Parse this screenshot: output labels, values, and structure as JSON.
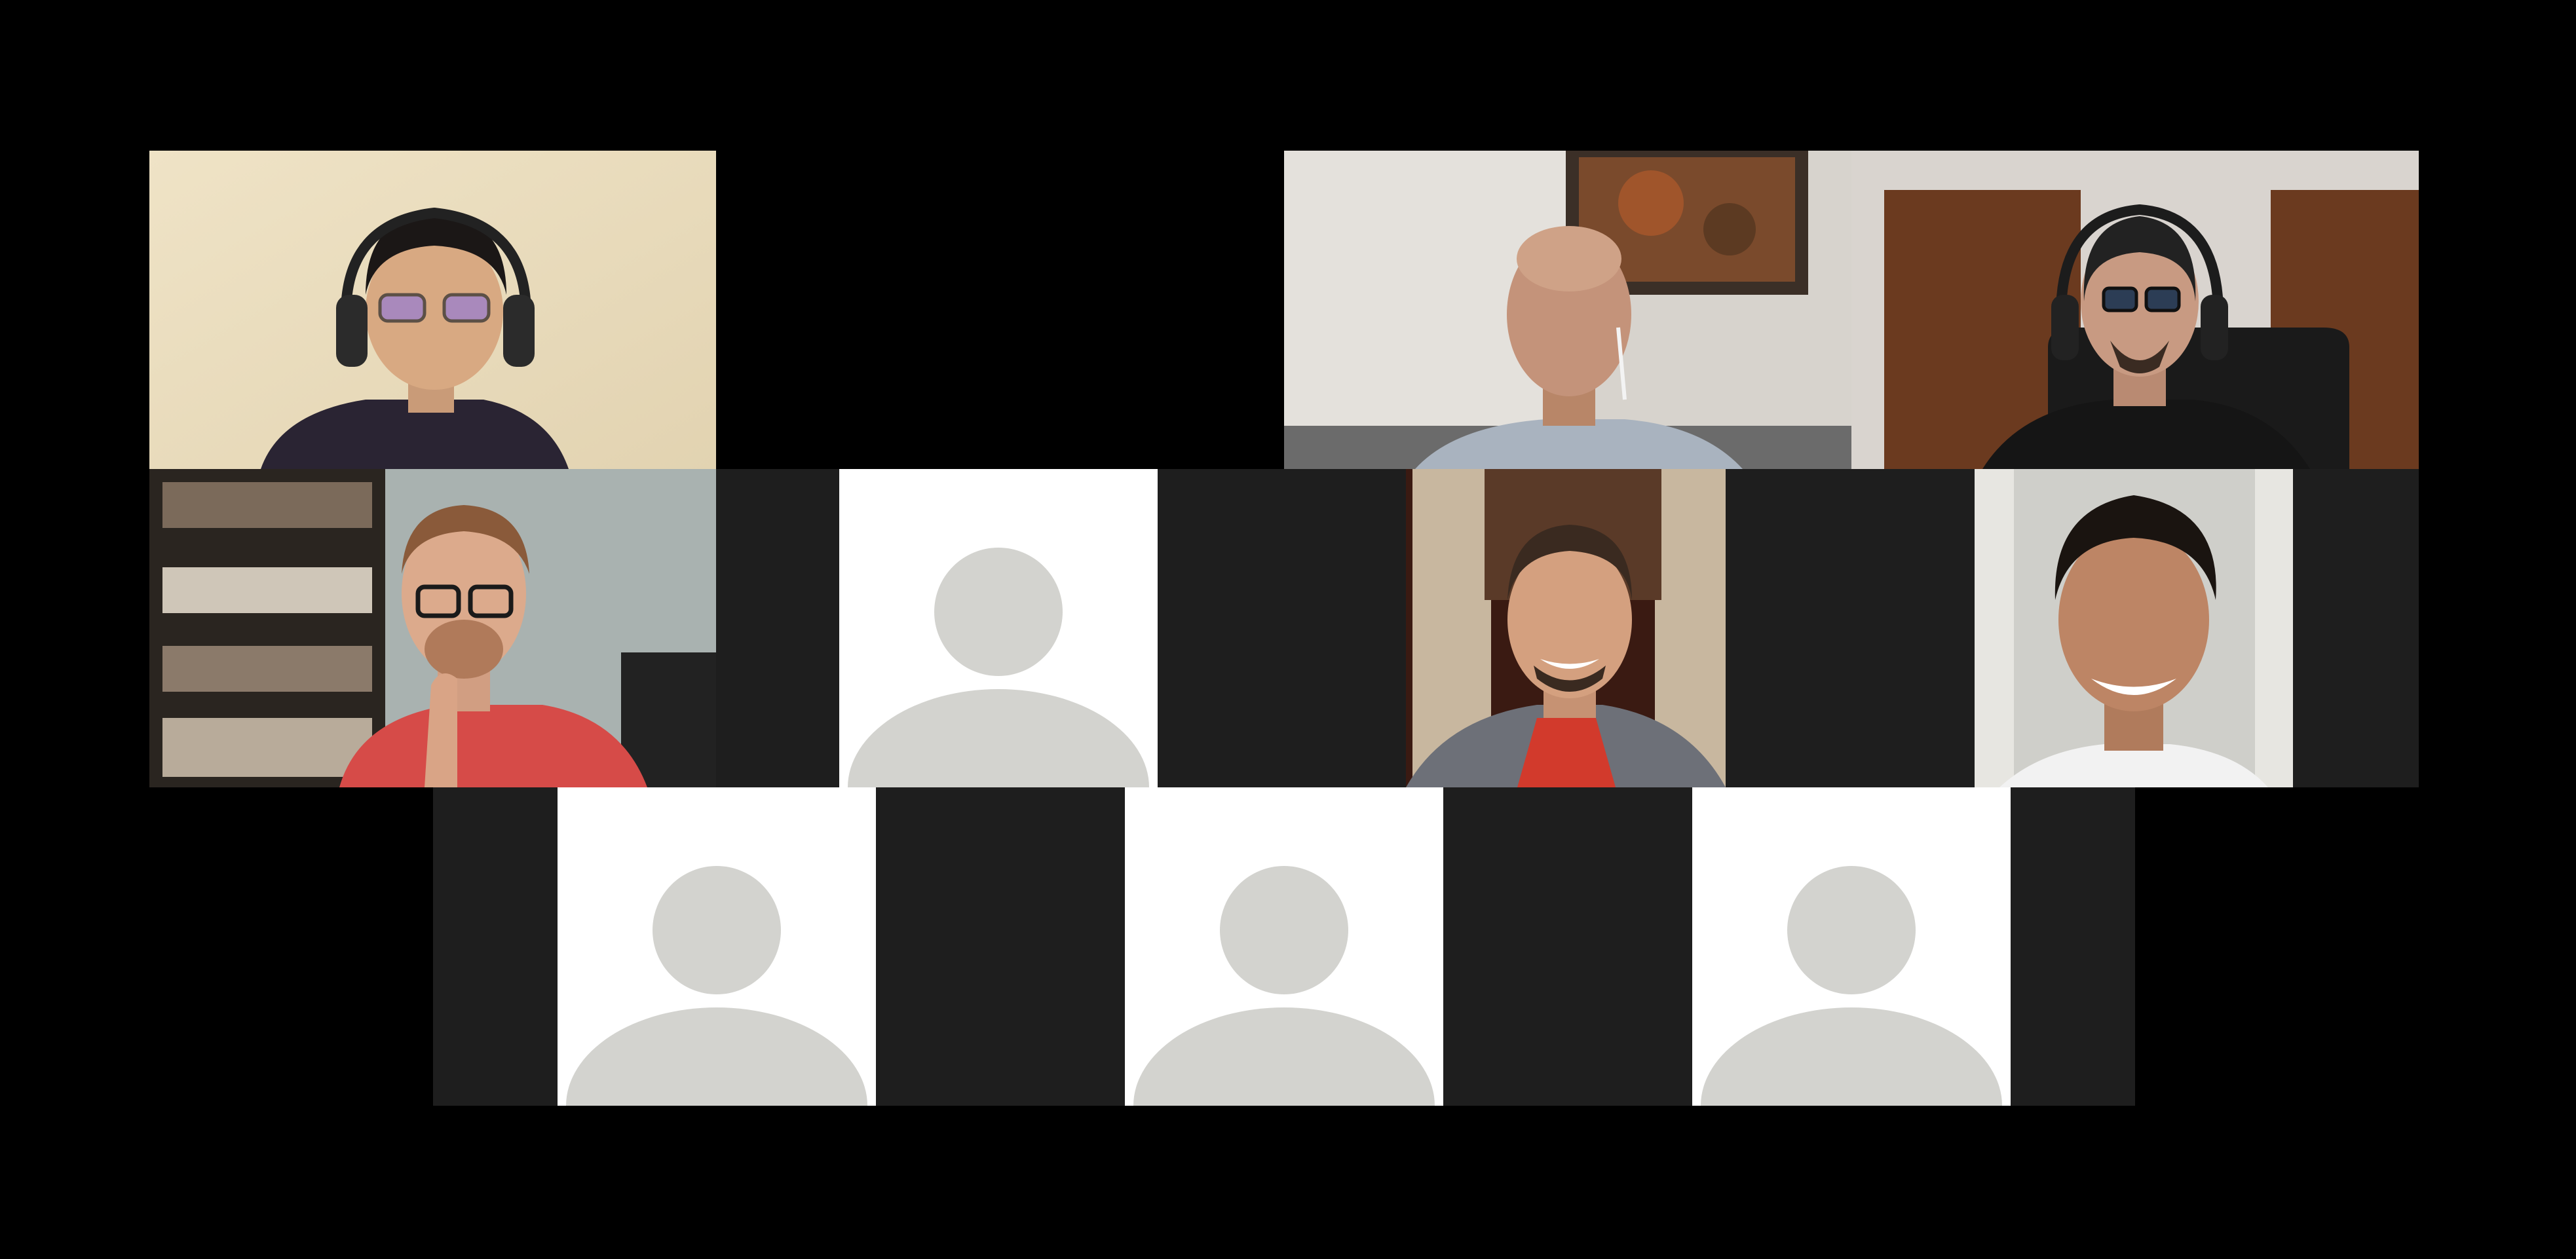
{
  "meeting": {
    "view": "gallery",
    "participant_count": 10,
    "colors": {
      "background": "#000000",
      "tile_letterbox": "#1e1e1e",
      "avatar_background": "#ffffff",
      "avatar_silhouette": "#d3d3cf"
    }
  },
  "participants": [
    {
      "kind": "video",
      "description_icon": "person-headphones-glasses"
    },
    {
      "kind": "video",
      "description_icon": "person-bald-earbud"
    },
    {
      "kind": "video",
      "description_icon": "person-headphones-beard"
    },
    {
      "kind": "video",
      "description_icon": "person-glasses-red-shirt"
    },
    {
      "kind": "avatar",
      "description_icon": "default-avatar-icon"
    },
    {
      "kind": "video",
      "description_icon": "person-smiling-red-jacket"
    },
    {
      "kind": "video",
      "description_icon": "person-smiling-white-shirt"
    },
    {
      "kind": "avatar",
      "description_icon": "default-avatar-icon"
    },
    {
      "kind": "avatar",
      "description_icon": "default-avatar-icon"
    },
    {
      "kind": "avatar",
      "description_icon": "default-avatar-icon"
    }
  ]
}
